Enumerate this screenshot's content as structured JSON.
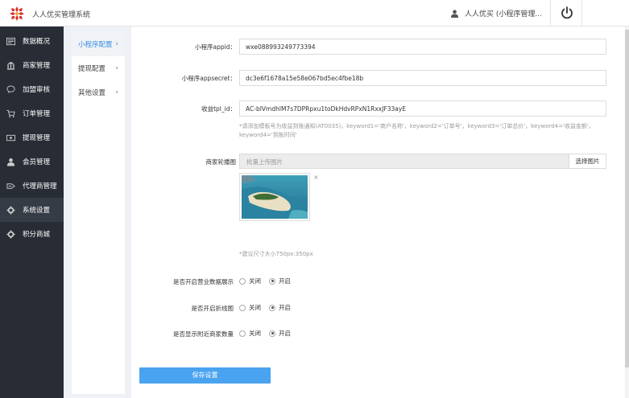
{
  "header": {
    "app_title": "人人优买管理系统",
    "user_name": "人人优买 (小程序管理..."
  },
  "sidebar": {
    "items": [
      {
        "label": "数据概况",
        "icon": "dashboard-icon"
      },
      {
        "label": "商家管理",
        "icon": "store-icon"
      },
      {
        "label": "加盟审核",
        "icon": "chat-icon"
      },
      {
        "label": "订单管理",
        "icon": "cart-icon"
      },
      {
        "label": "提现管理",
        "icon": "wallet-icon"
      },
      {
        "label": "会员管理",
        "icon": "user-icon"
      },
      {
        "label": "代理商管理",
        "icon": "agent-icon"
      },
      {
        "label": "系统设置",
        "icon": "gear-icon"
      },
      {
        "label": "积分商城",
        "icon": "gift-icon"
      }
    ],
    "active": "系统设置"
  },
  "subnav": {
    "items": [
      {
        "label": "小程序配置"
      },
      {
        "label": "提现配置"
      },
      {
        "label": "其他设置"
      }
    ],
    "active": "小程序配置"
  },
  "form": {
    "appid_label": "小程序appid：",
    "appid_value": "wxe088993249773394",
    "appsecret_label": "小程序appsecret：",
    "appsecret_value": "dc3e6f1678a15e58e067bd5ec4fbe18b",
    "tpl_label": "收益tpl_id：",
    "tpl_value": "AC-bIVmdhlM7s7DPRpxu1toDkHdvRPxN1RxxJF33ayE",
    "tpl_hint_line1": "*请添加模板号为收益到账通知(AT0035)，keyword1='商户名称'，keyword2='订单号'，keyword3='订单总价'，keyword4='收益金额'，",
    "tpl_hint_line2": "keyword4='到账时间'",
    "banner_label": "商家轮播图",
    "banner_placeholder": "批量上传图片",
    "banner_button": "选择图片",
    "banner_close": "×",
    "banner_hint": "*建议尺寸大小750px:350px",
    "toggles": [
      {
        "label": "是否开启营业数据展示",
        "off_label": "关闭",
        "on_label": "开启",
        "value": "开启"
      },
      {
        "label": "是否开启折线图",
        "off_label": "关闭",
        "on_label": "开启",
        "value": "开启"
      },
      {
        "label": "是否显示附近商家数量",
        "off_label": "关闭",
        "on_label": "开启",
        "value": "开启"
      }
    ],
    "save_label": "保存设置"
  },
  "colors": {
    "sidebar_bg": "#282d35",
    "accent": "#4aa3f0",
    "active_subnav_text": "#3a8ee6"
  }
}
